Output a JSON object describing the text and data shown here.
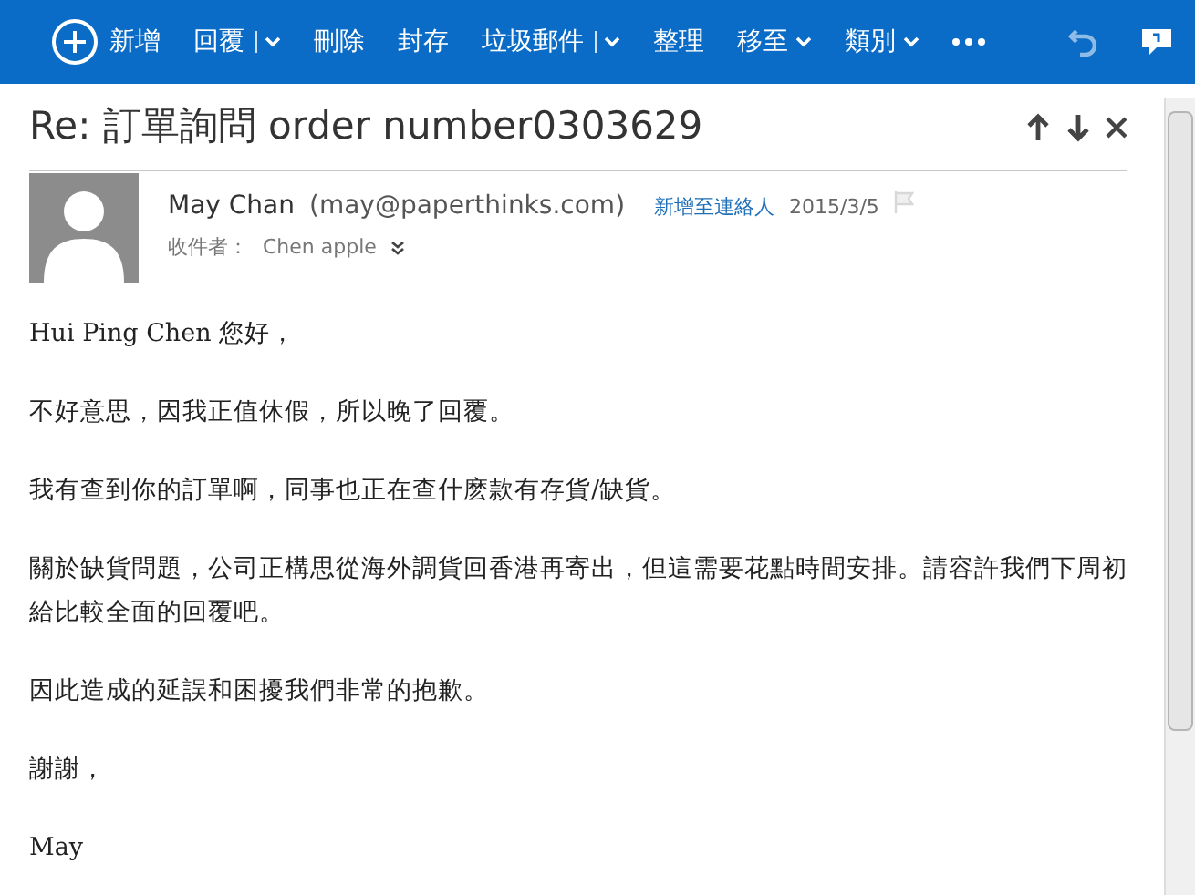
{
  "toolbar": [
    {
      "kind": "new",
      "label": "新增"
    },
    {
      "kind": "split",
      "label": "回覆"
    },
    {
      "kind": "plain",
      "label": "刪除"
    },
    {
      "kind": "plain",
      "label": "封存"
    },
    {
      "kind": "split",
      "label": "垃圾郵件"
    },
    {
      "kind": "plain",
      "label": "整理"
    },
    {
      "kind": "menu",
      "label": "移至"
    },
    {
      "kind": "menu",
      "label": "類別"
    },
    {
      "kind": "more"
    }
  ],
  "message": {
    "subject": "Re: 訂單詢問 order number0303629",
    "sender_name": "May Chan",
    "sender_email": "(may@paperthinks.com)",
    "add_contact": "新增至連絡人",
    "date": "2015/3/5",
    "to_label": "收件者：",
    "to": "Chen apple",
    "body": [
      "Hui Ping Chen 您好，",
      "不好意思，因我正值休假，所以晚了回覆。",
      "我有查到你的訂單啊，同事也正在查什麽款有存貨/缺貨。",
      "關於缺貨問題，公司正構思從海外調貨回香港再寄出，但這需要花點時間安排。請容許我們下周初給比較全面的回覆吧。",
      "因此造成的延誤和困擾我們非常的抱歉。",
      "謝謝，",
      "May"
    ]
  }
}
